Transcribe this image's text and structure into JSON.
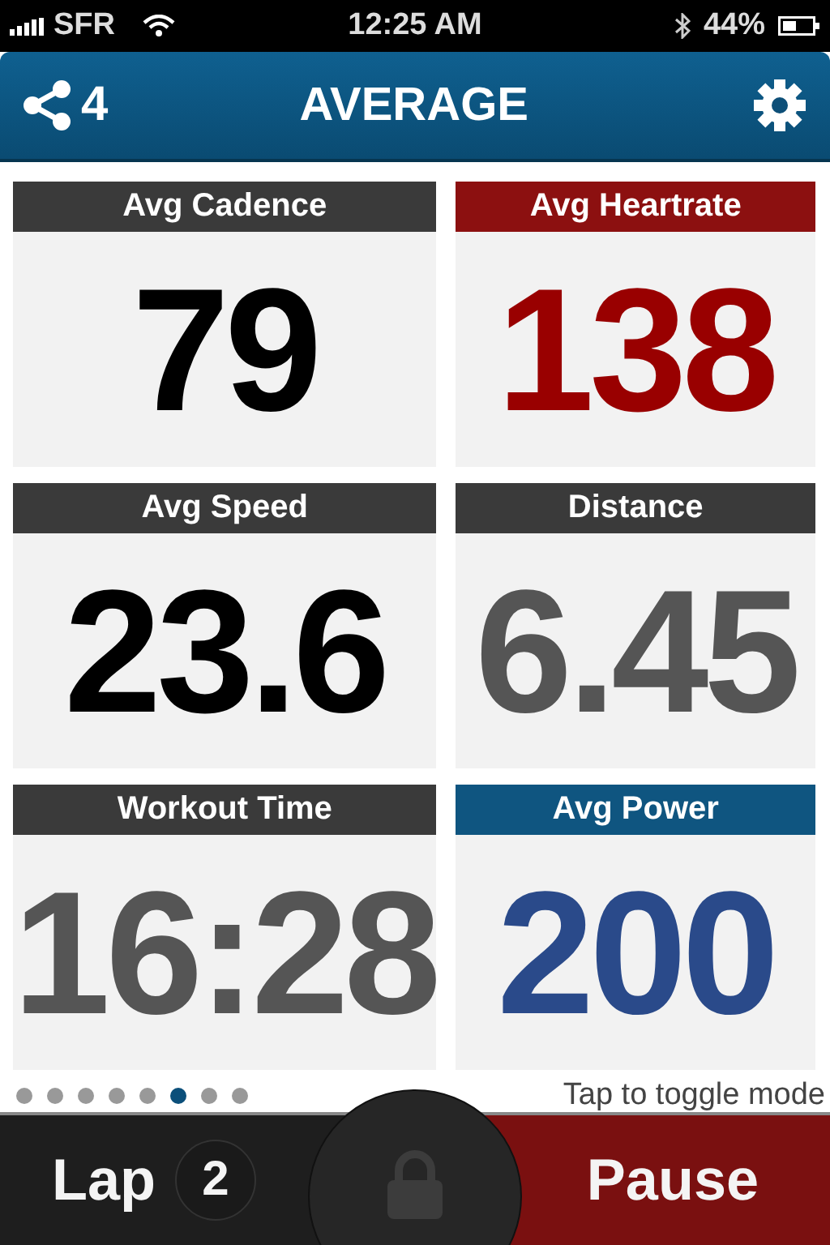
{
  "status_bar": {
    "carrier": "SFR",
    "time": "12:25 AM",
    "battery": "44%"
  },
  "nav_bar": {
    "share_count": "4",
    "title": "AVERAGE"
  },
  "tiles": [
    {
      "label": "Avg Cadence",
      "value": "79",
      "kind": "plain"
    },
    {
      "label": "Avg Heartrate",
      "value": "138",
      "kind": "heart"
    },
    {
      "label": "Avg Speed",
      "value": "23.6",
      "kind": "plain"
    },
    {
      "label": "Distance",
      "value": "6.45",
      "kind": "muted"
    },
    {
      "label": "Workout Time",
      "value": "16:28",
      "kind": "muted"
    },
    {
      "label": "Avg Power",
      "value": "200",
      "kind": "power"
    }
  ],
  "page_dots": [
    {
      "selected": false
    },
    {
      "selected": false
    },
    {
      "selected": false
    },
    {
      "selected": false
    },
    {
      "selected": false
    },
    {
      "selected": true
    },
    {
      "selected": false
    },
    {
      "selected": false
    }
  ],
  "hint": "Tap to toggle mode",
  "bottom_bar": {
    "lap_label": "Lap",
    "lap_count": "2",
    "pause_label": "Pause"
  }
}
